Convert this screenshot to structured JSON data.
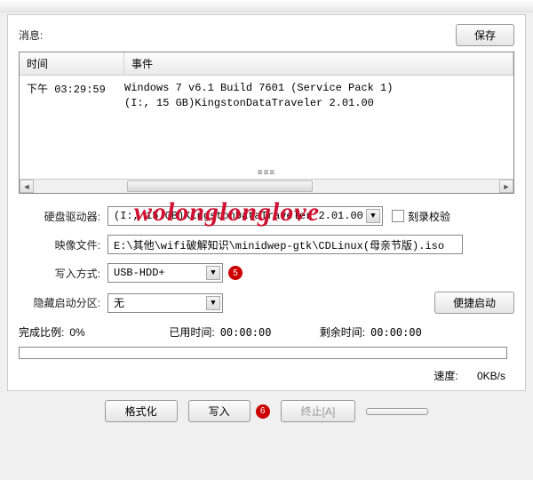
{
  "header": {
    "info_label": "消息:",
    "save_label": "保存"
  },
  "log": {
    "col_time": "时间",
    "col_event": "事件",
    "row_time": "下午 03:29:59",
    "event_text": "Windows 7 v6.1 Build 7601 (Service Pack 1)\n(I:, 15 GB)KingstonDataTraveler 2.01.00"
  },
  "watermark": "wolonglonglove",
  "form": {
    "drive_label": "硬盘驱动器:",
    "drive_value": "(I:, 15 GB)KingstonDataTraveler 2.01.00",
    "verify_label": "刻录校验",
    "image_label": "映像文件:",
    "image_value": "E:\\其他\\wifi破解知识\\minidwep-gtk\\CDLinux(母亲节版).iso",
    "write_label": "写入方式:",
    "write_value": "USB-HDD+",
    "hide_label": "隐藏启动分区:",
    "hide_value": "无",
    "portable_label": "便捷启动"
  },
  "stats": {
    "progress_label": "完成比例:",
    "progress_value": "0%",
    "elapsed_label": "已用时间:",
    "elapsed_value": "00:00:00",
    "remain_label": "剩余时间:",
    "remain_value": "00:00:00",
    "speed_label": "速度:",
    "speed_value": "0KB/s"
  },
  "buttons": {
    "format": "格式化",
    "write": "写入",
    "abort": "终止[A]"
  },
  "annotations": {
    "a5": "5",
    "a6": "6"
  }
}
